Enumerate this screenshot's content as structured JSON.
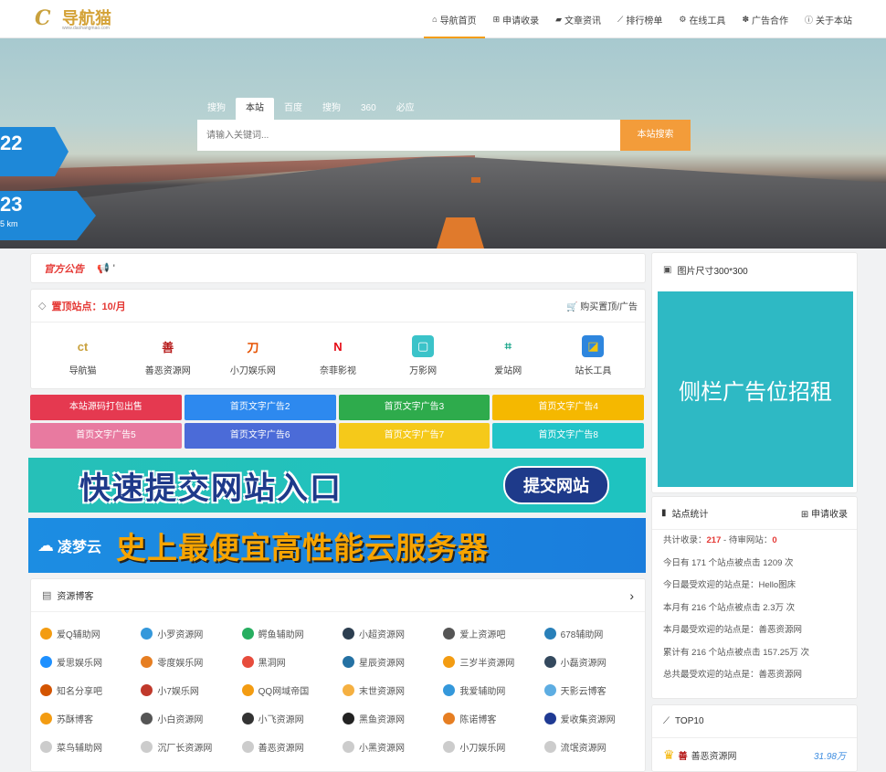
{
  "logo": {
    "text": "导航猫",
    "sub": "www.daohangmao.com"
  },
  "nav": [
    {
      "icon": "home-icon",
      "glyph": "⌂",
      "label": "导航首页",
      "active": true
    },
    {
      "icon": "plus-square-icon",
      "glyph": "⊞",
      "label": "申请收录"
    },
    {
      "icon": "folder-icon",
      "glyph": "▰",
      "label": "文章资讯"
    },
    {
      "icon": "chart-line-icon",
      "glyph": "⟋",
      "label": "排行榜单"
    },
    {
      "icon": "gears-icon",
      "glyph": "⚙",
      "label": "在线工具"
    },
    {
      "icon": "paw-icon",
      "glyph": "✽",
      "label": "广告合作"
    },
    {
      "icon": "info-icon",
      "glyph": "ⓘ",
      "label": "关于本站"
    }
  ],
  "banner": {
    "tag1": "22",
    "tag2": "23",
    "tag2_sub": "5 km"
  },
  "search": {
    "tabs": [
      "搜狗",
      "本站",
      "百度",
      "搜狗",
      "360",
      "必应"
    ],
    "active_tab": 1,
    "placeholder": "请输入关键词...",
    "button": "本站搜索"
  },
  "notice": {
    "title": "官方公告",
    "text": "'"
  },
  "topsites": {
    "title": "置顶站点：10/月",
    "buy": "购买置顶/广告",
    "items": [
      {
        "label": "导航猫",
        "icon": "daohangmao-logo-icon",
        "color": "#ffffff",
        "fg": "#c9a13d",
        "glyph": "ct"
      },
      {
        "label": "善恶资源网",
        "icon": "shaneziyuan-logo-icon",
        "color": "#ffffff",
        "fg": "#b71c1c",
        "glyph": "善"
      },
      {
        "label": "小刀娱乐网",
        "icon": "xiaodao-logo-icon",
        "color": "#ffffff",
        "fg": "#e65100",
        "glyph": "刀"
      },
      {
        "label": "奈菲影视",
        "icon": "naifei-logo-icon",
        "color": "#ffffff",
        "fg": "#e50914",
        "glyph": "N"
      },
      {
        "label": "万影网",
        "icon": "wanying-logo-icon",
        "color": "#3bc3c9",
        "fg": "#ffffff",
        "glyph": "▢"
      },
      {
        "label": "爱站网",
        "icon": "aizhan-logo-icon",
        "color": "#ffffff",
        "fg": "#17a589",
        "glyph": "⌗"
      },
      {
        "label": "站长工具",
        "icon": "zhanzhang-logo-icon",
        "color": "#2e86de",
        "fg": "#f1c40f",
        "glyph": "◪"
      }
    ]
  },
  "text_ads": [
    {
      "label": "本站源码打包出售",
      "color": "#e53950"
    },
    {
      "label": "首页文字广告2",
      "color": "#2d89ef"
    },
    {
      "label": "首页文字广告3",
      "color": "#2eab4c"
    },
    {
      "label": "首页文字广告4",
      "color": "#f5b800"
    },
    {
      "label": "首页文字广告5",
      "color": "#e87aa0"
    },
    {
      "label": "首页文字广告6",
      "color": "#4b6bd8"
    },
    {
      "label": "首页文字广告7",
      "color": "#f5c91a"
    },
    {
      "label": "首页文字广告8",
      "color": "#22c4c8"
    }
  ],
  "banner_ads": {
    "ad1_text": "快速提交网站入口",
    "ad1_button": "提交网站",
    "ad2_brand": "凌梦云",
    "ad2_text": "史上最便宜高性能云服务器"
  },
  "blogs": {
    "title": "资源博客",
    "more": "›",
    "items": [
      {
        "label": "爱Q辅助网",
        "color": "#f39c12"
      },
      {
        "label": "小罗资源网",
        "color": "#3498db"
      },
      {
        "label": "鳄鱼辅助网",
        "color": "#27ae60"
      },
      {
        "label": "小超资源网",
        "color": "#2c3e50"
      },
      {
        "label": "爱上资源吧",
        "color": "#555555"
      },
      {
        "label": "678辅助网",
        "color": "#2980b9"
      },
      {
        "label": "爱思娱乐网",
        "color": "#1e90ff"
      },
      {
        "label": "零度娱乐网",
        "color": "#e67e22"
      },
      {
        "label": "黑洞网",
        "color": "#e74c3c"
      },
      {
        "label": "星辰资源网",
        "color": "#2471a3"
      },
      {
        "label": "三岁半资源网",
        "color": "#f39c12"
      },
      {
        "label": "小磊资源网",
        "color": "#34495e"
      },
      {
        "label": "知名分享吧",
        "color": "#d35400"
      },
      {
        "label": "小7娱乐网",
        "color": "#c0392b"
      },
      {
        "label": "QQ网域帝国",
        "color": "#f39c12"
      },
      {
        "label": "末世资源网",
        "color": "#f5b041"
      },
      {
        "label": "我爱辅助网",
        "color": "#3498db"
      },
      {
        "label": "天影云博客",
        "color": "#5dade2"
      },
      {
        "label": "苏酥博客",
        "color": "#f39c12"
      },
      {
        "label": "小白资源网",
        "color": "#555555"
      },
      {
        "label": "小飞资源网",
        "color": "#333333"
      },
      {
        "label": "黑鱼资源网",
        "color": "#222222"
      },
      {
        "label": "陈诺博客",
        "color": "#e67e22"
      },
      {
        "label": "爱收集资源网",
        "color": "#1f3a93"
      },
      {
        "label": "菜鸟辅助网",
        "color": "#cccccc"
      },
      {
        "label": "沉厂长资源网",
        "color": "#cccccc"
      },
      {
        "label": "善恶资源网",
        "color": "#cccccc"
      },
      {
        "label": "小黑资源网",
        "color": "#cccccc"
      },
      {
        "label": "小刀娱乐网",
        "color": "#cccccc"
      },
      {
        "label": "流氓资源网",
        "color": "#cccccc"
      }
    ]
  },
  "side_image": {
    "title": "图片尺寸300*300",
    "ad_text": "侧栏广告位招租"
  },
  "stats": {
    "title": "站点统计",
    "apply": "申请收录",
    "total_label": "共计收录：",
    "total": "217",
    "pending_label": " - 待审网站：",
    "pending": "0",
    "lines": [
      "今日有 171 个站点被点击 1209 次",
      "今日最受欢迎的站点是：Hello图床",
      "本月有 216 个站点被点击 2.3万 次",
      "本月最受欢迎的站点是：善恶资源网",
      "累计有 216 个站点被点击 157.25万 次",
      "总共最受欢迎的站点是：善恶资源网"
    ]
  },
  "top10": {
    "title": "TOP10",
    "first_name": "善恶资源网",
    "first_value": "31.98万"
  }
}
